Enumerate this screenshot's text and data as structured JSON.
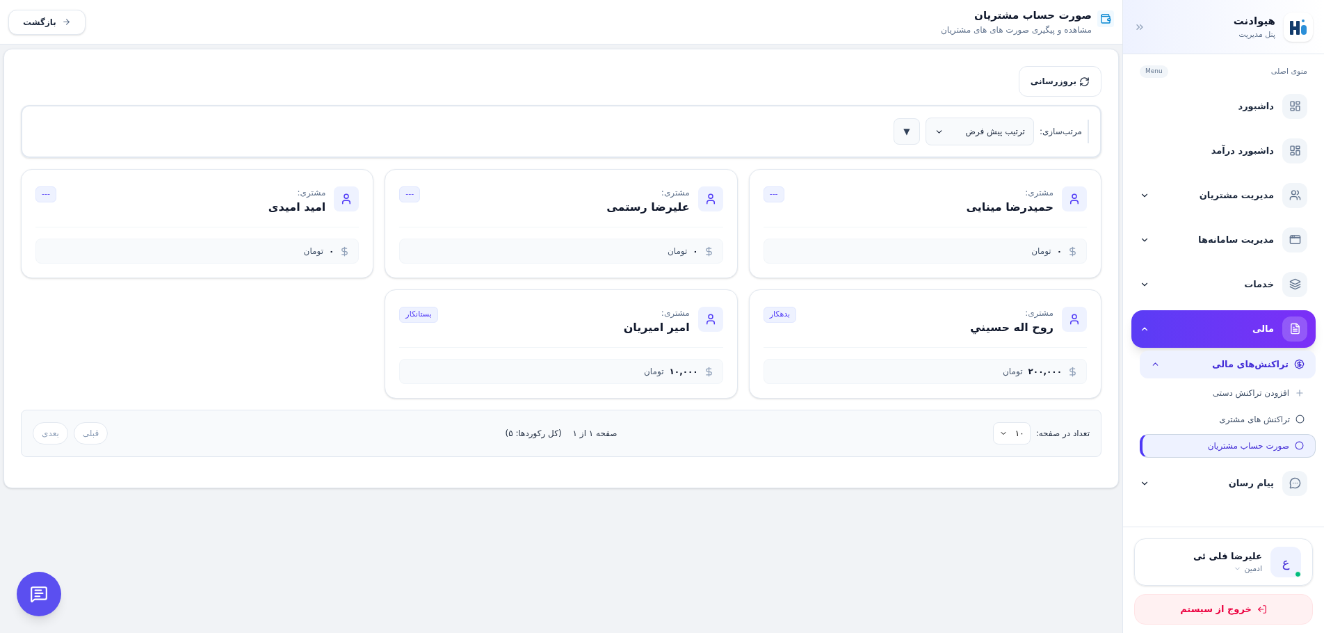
{
  "header": {
    "title": "صورت حساب مشتریان",
    "subtitle": "مشاهده و پیگیری صورت های های مشتریان",
    "back_button": "بازگشت"
  },
  "toolbar": {
    "refresh_button": "بروزرسانی"
  },
  "filter": {
    "sort_label": "مرتب‌سازی:",
    "sort_value": "ترتیب پیش فرض",
    "direction_button": "▼"
  },
  "customers": [
    {
      "label": "مشتری:",
      "name": "حمیدرضا مینایی",
      "badge": "---",
      "amount": "۰",
      "currency": "تومان"
    },
    {
      "label": "مشتری:",
      "name": "علیرضا رستمی",
      "badge": "---",
      "amount": "۰",
      "currency": "تومان"
    },
    {
      "label": "مشتری:",
      "name": "امید امیدی",
      "badge": "---",
      "amount": "۰",
      "currency": "تومان"
    },
    {
      "label": "مشتری:",
      "name": "روح اله حسيني",
      "badge": "بدهکار",
      "amount": "۲۰۰,۰۰۰",
      "currency": "تومان"
    },
    {
      "label": "مشتری:",
      "name": "امیر امیریان",
      "badge": "بستانکار",
      "amount": "۱۰,۰۰۰",
      "currency": "تومان"
    }
  ],
  "pagination": {
    "per_page_label": "تعداد در صفحه:",
    "per_page": "۱۰",
    "page_info": "صفحه ۱ از ۱",
    "total": "(کل رکوردها: ۵)",
    "prev_button": "قبلی",
    "next_button": "بعدی",
    "prev_disabled": true,
    "next_disabled": true
  },
  "sidebar": {
    "brand": "هیوادنت",
    "brand_subtitle": "پنل مدیریت",
    "section_label": "منوی اصلی",
    "section_badge": "Menu",
    "items": [
      {
        "label": "داشبورد",
        "selected": false
      },
      {
        "label": "داشبورد درآمد",
        "selected": false
      },
      {
        "label": "مدیریت مشتریان",
        "selected": false,
        "expanded": false
      },
      {
        "label": "مدیریت سامانه‌ها",
        "selected": false,
        "expanded": false
      },
      {
        "label": "خدمات",
        "selected": false,
        "expanded": false
      },
      {
        "label": "مالی",
        "selected": true,
        "expanded": true,
        "children": [
          {
            "label": "تراکنش‌های مالی",
            "expanded": true,
            "children": [
              {
                "label": "افزودن تراکنش دستی",
                "kind": "add",
                "selected": false
              },
              {
                "label": "تراکنش های مشتری",
                "kind": "link",
                "selected": false
              },
              {
                "label": "صورت حساب مشتریان",
                "kind": "link",
                "selected": true
              }
            ]
          }
        ]
      },
      {
        "label": "پیام رسان",
        "selected": false,
        "expanded": false
      }
    ],
    "user": {
      "avatar": "ع",
      "name": "علیرضا قلی ئی",
      "role": "ادمین",
      "online": true
    },
    "logout_button": "خروج از سیستم"
  }
}
